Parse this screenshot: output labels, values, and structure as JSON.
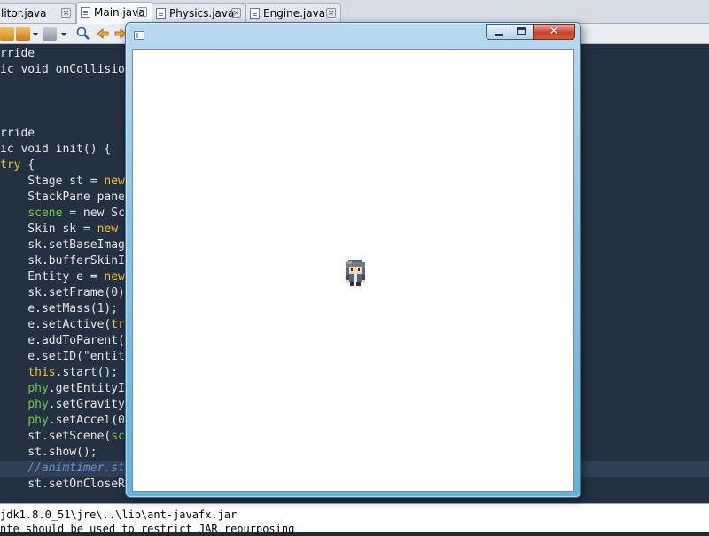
{
  "tabs": [
    {
      "label": "litor.java",
      "active": false
    },
    {
      "label": "Main.java",
      "active": true
    },
    {
      "label": "Physics.java",
      "active": false
    },
    {
      "label": "Engine.java",
      "active": false
    }
  ],
  "tab_close_glyph": "×",
  "code_lines": [
    [
      {
        "t": "rride",
        "c": ""
      }
    ],
    [
      {
        "t": "ic void onCollisio",
        "c": ""
      }
    ],
    [
      {
        "t": "",
        "c": ""
      }
    ],
    [
      {
        "t": "",
        "c": ""
      }
    ],
    [
      {
        "t": "",
        "c": ""
      }
    ],
    [
      {
        "t": "rride",
        "c": ""
      }
    ],
    [
      {
        "t": "ic void init() {",
        "c": ""
      }
    ],
    [
      {
        "t": "try",
        "c": "kw"
      },
      {
        "t": " {",
        "c": ""
      }
    ],
    [
      {
        "t": "    Stage st = ",
        "c": ""
      },
      {
        "t": "new",
        "c": "kw"
      }
    ],
    [
      {
        "t": "    StackPane pane",
        "c": ""
      }
    ],
    [
      {
        "t": "    ",
        "c": ""
      },
      {
        "t": "scene",
        "c": "fld"
      },
      {
        "t": " = new Sc",
        "c": ""
      }
    ],
    [
      {
        "t": "    Skin sk = ",
        "c": ""
      },
      {
        "t": "new",
        "c": "kw"
      }
    ],
    [
      {
        "t": "    sk.setBaseImag",
        "c": ""
      },
      {
        "t": "                                       ))));",
        "c": ""
      }
    ],
    [
      {
        "t": "    sk.bufferSkinI",
        "c": ""
      }
    ],
    [
      {
        "t": "    Entity e = ",
        "c": ""
      },
      {
        "t": "new",
        "c": "kw"
      }
    ],
    [
      {
        "t": "    sk.setFrame(0)",
        "c": ""
      }
    ],
    [
      {
        "t": "    e.setMass(1);",
        "c": ""
      }
    ],
    [
      {
        "t": "    e.setActive(",
        "c": ""
      },
      {
        "t": "tr",
        "c": "kw"
      }
    ],
    [
      {
        "t": "    e.addToParent(",
        "c": ""
      }
    ],
    [
      {
        "t": "    e.setID(\"entit",
        "c": ""
      }
    ],
    [
      {
        "t": "    ",
        "c": ""
      },
      {
        "t": "this",
        "c": "kw"
      },
      {
        "t": ".start();",
        "c": ""
      }
    ],
    [
      {
        "t": "    ",
        "c": ""
      },
      {
        "t": "phy",
        "c": "fld"
      },
      {
        "t": ".getEntityI",
        "c": ""
      }
    ],
    [
      {
        "t": "    ",
        "c": ""
      },
      {
        "t": "phy",
        "c": "fld"
      },
      {
        "t": ".setGravity",
        "c": ""
      }
    ],
    [
      {
        "t": "    ",
        "c": ""
      },
      {
        "t": "phy",
        "c": "fld"
      },
      {
        "t": ".setAccel(0",
        "c": ""
      }
    ],
    [
      {
        "t": "    st.setScene(",
        "c": ""
      },
      {
        "t": "sc",
        "c": "fld"
      }
    ],
    [
      {
        "t": "    st.show();",
        "c": ""
      }
    ],
    [
      {
        "t": "    //animtimer.st",
        "c": "cm"
      }
    ],
    [
      {
        "t": "    st.setOnCloseR",
        "c": ""
      }
    ]
  ],
  "highlighted_line": 26,
  "output_lines": [
    "jdk1.8.0_51\\jre\\..\\lib\\ant-javafx.jar",
    "nte should be used to restrict JAR repurposing"
  ],
  "app_window": {
    "close_glyph": "✕"
  },
  "colors": {
    "editor_bg": "#233140",
    "keyword": "#f1c33c",
    "field": "#73c84a",
    "comment": "#6a8fd0",
    "window_frame": "#8fc4e6"
  }
}
